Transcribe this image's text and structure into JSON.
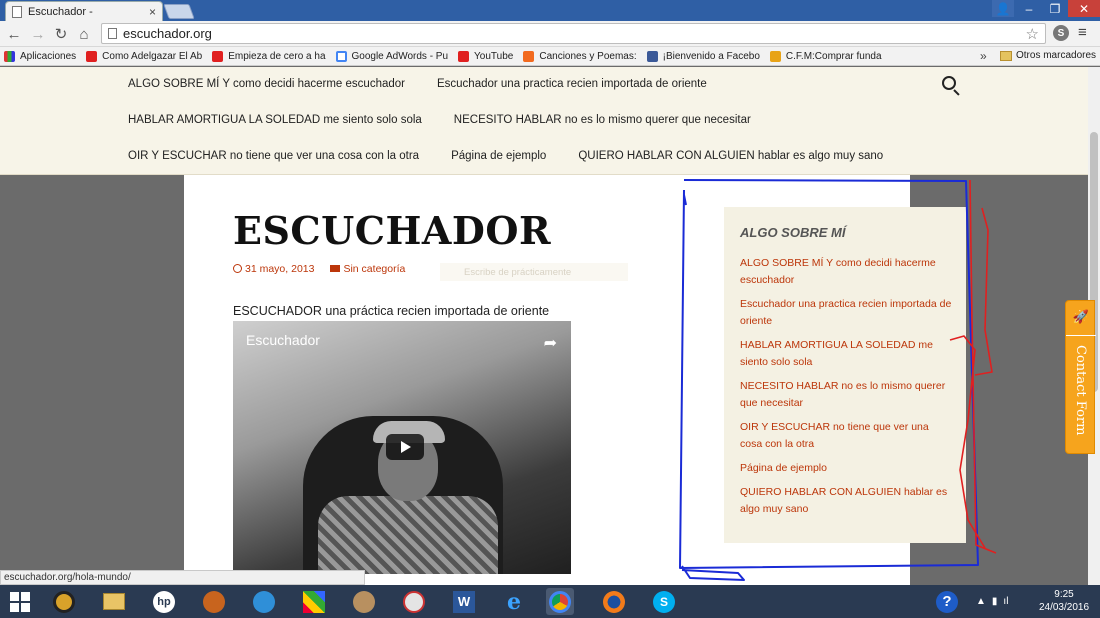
{
  "browser": {
    "tab_title": "Escuchador -",
    "tab_close": "×",
    "url": "escuchador.org",
    "window_min": "–",
    "window_max": "❐",
    "window_close": "✕"
  },
  "bookmarks": {
    "items": [
      "Aplicaciones",
      "Como Adelgazar El Ab",
      "Empieza de cero a ha",
      "Google AdWords - Pu",
      "YouTube",
      "Canciones y Poemas:",
      "¡Bienvenido a Facebo",
      "C.F.M:Comprar funda"
    ],
    "more": "»",
    "other": "Otros marcadores"
  },
  "nav": {
    "row1": [
      "ALGO SOBRE MÍ Y como decidi hacerme escuchador",
      "Escuchador una practica recien importada de oriente"
    ],
    "row2": [
      "HABLAR AMORTIGUA LA SOLEDAD me siento solo sola",
      "NECESITO HABLAR no es lo mismo querer que necesitar"
    ],
    "row3": [
      "OIR Y ESCUCHAR no tiene que ver una cosa con la otra",
      "Página de ejemplo",
      "QUIERO HABLAR CON ALGUIEN hablar es algo muy sano"
    ]
  },
  "post": {
    "title": "ESCUCHADOR",
    "date": "31 mayo, 2013",
    "category": "Sin categoría",
    "ghost_text": "Escribe de prácticamente",
    "subtitle": "ESCUCHADOR una práctica recien importada de oriente",
    "video_title": "Escuchador"
  },
  "widget": {
    "title": "ALGO SOBRE MÍ",
    "links": [
      "ALGO SOBRE MÍ Y como decidi hacerme escuchador",
      "Escuchador una practica recien importada de oriente",
      "HABLAR AMORTIGUA LA SOLEDAD me siento solo sola",
      "NECESITO HABLAR no es lo mismo querer que necesitar",
      "OIR Y ESCUCHAR no tiene que ver una cosa con la otra",
      "Página de ejemplo",
      "QUIERO HABLAR CON ALGUIEN hablar es algo muy sano"
    ]
  },
  "contact_form": "Contact Form",
  "status_url": "escuchador.org/hola-mundo/",
  "clock": {
    "time": "9:25",
    "date": "24/03/2016"
  },
  "colors": {
    "link": "#bc360a",
    "nav_bg": "#f7f4e8",
    "widget_bg": "#f4f1e3",
    "contact_tab": "#f6a41d",
    "taskbar": "#2a3a52"
  }
}
